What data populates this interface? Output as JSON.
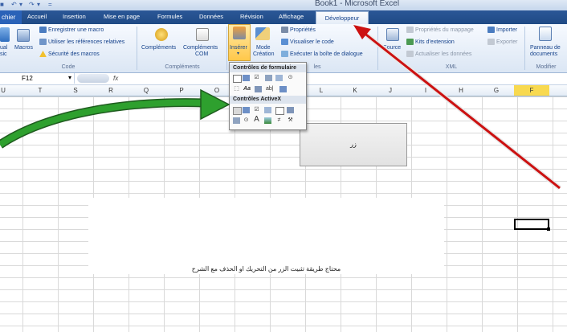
{
  "window": {
    "book": "Book1",
    "separator": " - ",
    "app": "Microsoft Excel"
  },
  "tabs": [
    "Accueil",
    "Insertion",
    "Mise en page",
    "Formules",
    "Données",
    "Révision",
    "Affichage"
  ],
  "file_tab": "chier",
  "active_tab": "Développeur",
  "ribbon": {
    "visual_basic": [
      "ual",
      "sic"
    ],
    "macros": "Macros",
    "record_macro": "Enregistrer une macro",
    "relative_refs": "Utiliser les références relatives",
    "macro_security": "Sécurité des macros",
    "group_code": "Code",
    "addins": "Compléments",
    "com_addins": [
      "Compléments",
      "COM"
    ],
    "group_addins": "Compléments",
    "insert": "Insérer",
    "design_mode": [
      "Mode",
      "Création"
    ],
    "properties": "Propriétés",
    "view_code": "Visualiser le code",
    "run_dialog": "Exécuter la boîte de dialogue",
    "group_controls_tail": "les",
    "source": "Source",
    "map_properties": "Propriétés du mappage",
    "expansion_packs": "Kits d'extension",
    "refresh_data": "Actualiser les données",
    "import": "Importer",
    "export": "Exporter",
    "group_xml": "XML",
    "doc_panel": [
      "Panneau de",
      "documents"
    ],
    "group_modify": "Modifier"
  },
  "dropdown": {
    "form_controls": "Contrôles de formulaire",
    "activex_controls": "Contrôles ActiveX",
    "form_row1_icons": [
      "combobox-icon",
      "listbox-icon",
      "checkbox-icon",
      "spinner-icon",
      "listbox2-icon",
      "radio-icon"
    ],
    "form_row2_icons": [
      "groupbox-icon",
      "label-icon",
      "scrollbar-icon",
      "textfield-icon",
      "combo2-icon"
    ],
    "activex_row1_icons": [
      "button-icon",
      "combobox-icon",
      "checkbox-icon",
      "listbox-icon",
      "textbox-icon",
      "scrollbar-icon"
    ],
    "activex_row2_icons": [
      "spinbutton-icon",
      "radio-icon",
      "label-icon",
      "image-icon",
      "toggle-icon",
      "more-controls-icon"
    ]
  },
  "formula_bar": {
    "name_box": "F12",
    "fx": "fx"
  },
  "columns": [
    "U",
    "T",
    "S",
    "R",
    "Q",
    "P",
    "O",
    "N",
    "M",
    "L",
    "K",
    "J",
    "I",
    "H",
    "G",
    "F"
  ],
  "sheet": {
    "button_caption": "زر",
    "caption": "محتاج طريقة تثبيت الزر من التحريك او الحذف مع الشرح"
  },
  "colors": {
    "tab_strip": "#2b5797",
    "active_cell_col": "#f8d94f",
    "green_arrow": "#2ea02e",
    "red_arrow": "#cc1111"
  }
}
